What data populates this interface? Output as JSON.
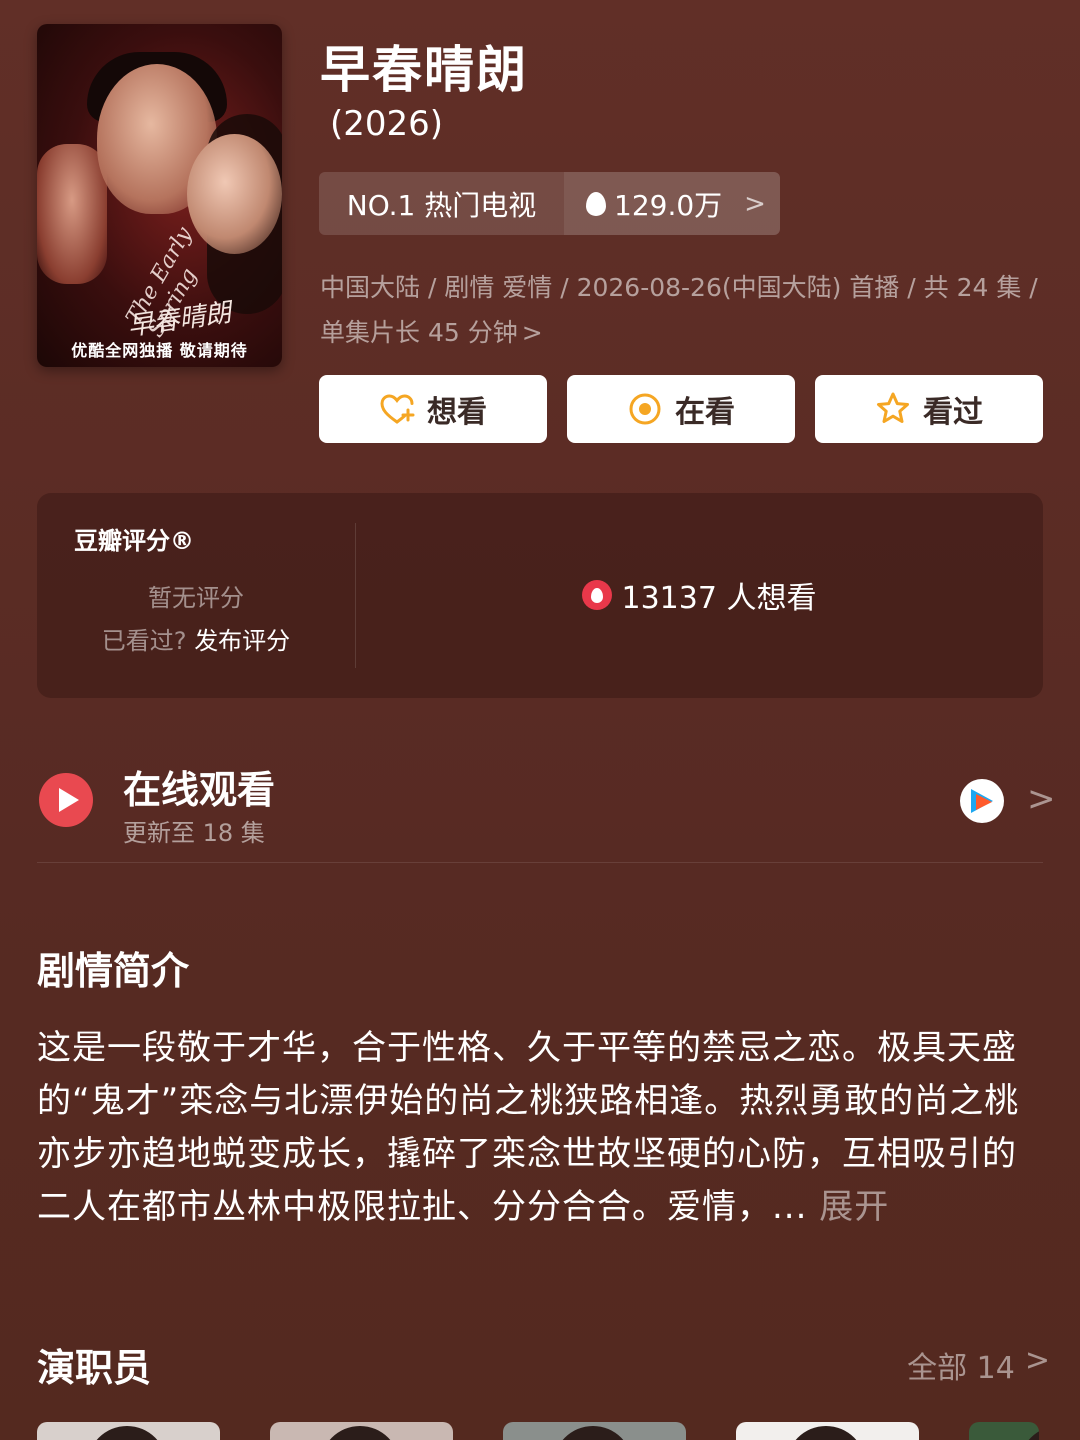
{
  "poster": {
    "script_title": "早春晴朗",
    "script_en": "The Early Spring",
    "caption": "优酷全网独播 敬请期待"
  },
  "header": {
    "title": "早春晴朗",
    "year": "(2026)"
  },
  "rank": {
    "label": "NO.1 热门电视",
    "heat": "129.0万"
  },
  "meta": {
    "text": "中国大陆 / 剧情 爱情 / 2026-08-26(中国大陆) 首播 / 共 24 集 / 单集片长 45 分钟"
  },
  "actions": {
    "want": "想看",
    "watching": "在看",
    "watched": "看过"
  },
  "rating": {
    "label": "豆瓣评分®",
    "no_score": "暂无评分",
    "seen_q": "已看过?",
    "publish": "发布评分",
    "want_count": "13137 人想看"
  },
  "online": {
    "title": "在线观看",
    "subtitle": "更新至 18 集"
  },
  "synopsis": {
    "title": "剧情简介",
    "text": "这是一段敬于才华，合于性格、久于平等的禁忌之恋。极具天盛的“鬼才”栾念与北漂伊始的尚之桃狭路相逢。热烈勇敢的尚之桃亦步亦趋地蜕变成长，撬碎了栾念世故坚硬的心防，互相吸引的二人在都市丛林中极限拉扯、分分合合。爱情，... ",
    "more": "展开"
  },
  "cast": {
    "title": "演职员",
    "all": "全部 14"
  },
  "colors": {
    "background": "#5c2d26",
    "accent_orange": "#f5a623",
    "play_red": "#e94950",
    "flame_red": "#e9384a"
  }
}
